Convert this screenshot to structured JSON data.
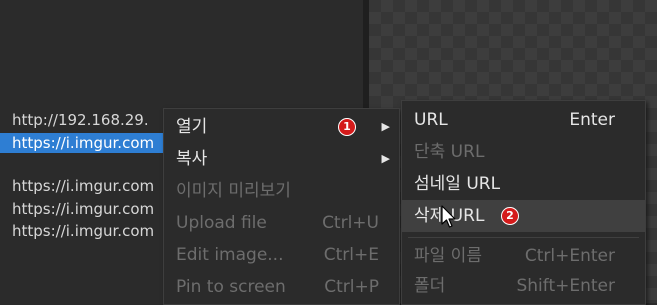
{
  "url_list": {
    "lines": [
      "http://192.168.29.",
      "https://i.imgur.com",
      "https://i.imgur.com",
      "https://i.imgur.com",
      "https://i.imgur.com"
    ]
  },
  "context_menu": {
    "items": [
      {
        "label": "열기",
        "shortcut": "",
        "submenu": true,
        "disabled": false
      },
      {
        "label": "복사",
        "shortcut": "",
        "submenu": true,
        "disabled": false
      },
      {
        "label": "이미지 미리보기",
        "shortcut": "",
        "submenu": false,
        "disabled": true
      },
      {
        "label": "Upload file",
        "shortcut": "Ctrl+U",
        "submenu": false,
        "disabled": true
      },
      {
        "label": "Edit image...",
        "shortcut": "Ctrl+E",
        "submenu": false,
        "disabled": true
      },
      {
        "label": "Pin to screen",
        "shortcut": "Ctrl+P",
        "submenu": false,
        "disabled": true
      }
    ]
  },
  "submenu": {
    "items": [
      {
        "label": "URL",
        "shortcut": "Enter",
        "disabled": false
      },
      {
        "label": "단축 URL",
        "shortcut": "",
        "disabled": true
      },
      {
        "label": "섬네일 URL",
        "shortcut": "",
        "disabled": false
      },
      {
        "label": "삭제 URL",
        "shortcut": "",
        "disabled": false
      },
      {
        "label": "파일 이름",
        "shortcut": "Ctrl+Enter",
        "disabled": true
      },
      {
        "label": "폴더",
        "shortcut": "Shift+Enter",
        "disabled": true
      }
    ]
  },
  "annotations": {
    "badge_1": "1",
    "badge_2": "2"
  },
  "colors": {
    "selection": "#2e7ed3",
    "badge": "#d41b1b",
    "menu_bg": "#2b2b2b"
  },
  "icons": {
    "submenu_arrow": "triangle-right",
    "cursor": "mouse-pointer"
  }
}
